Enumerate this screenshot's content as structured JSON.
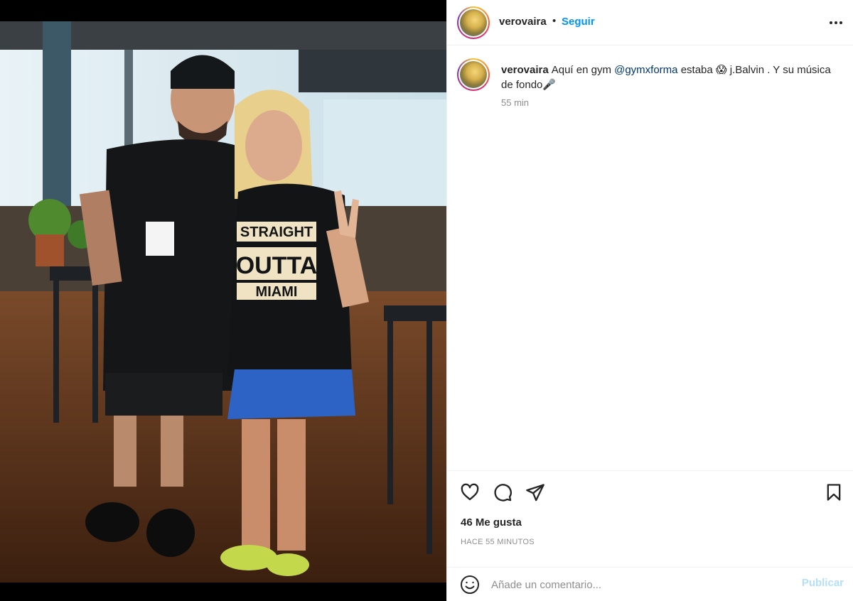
{
  "post": {
    "username": "verovaira",
    "separator": "•",
    "follow_label": "Seguir",
    "more_icon": "more-options-icon",
    "photo_shirt_text": [
      "STRAIGHT",
      "OUTTA",
      "MIAMI"
    ],
    "caption": {
      "username": "verovaira",
      "text_1": "Aquí en gym ",
      "mention": "@gymxforma",
      "text_2": " estaba ",
      "emoji_1": "😱",
      "text_3": " j.Balvin . Y su música de fondo",
      "emoji_2": "🎤"
    },
    "caption_time": "55 min",
    "actions": {
      "like_icon": "heart-icon",
      "comment_icon": "comment-icon",
      "share_icon": "share-icon",
      "save_icon": "bookmark-icon"
    },
    "likes_text": "46 Me gusta",
    "posted_ago": "HACE 55 MINUTOS",
    "comment": {
      "emoji_icon": "smiley-icon",
      "placeholder": "Añade un comentario...",
      "publish_label": "Publicar"
    }
  },
  "colors": {
    "accent_blue": "#0095f6",
    "publish_disabled": "#b2dffc",
    "mention": "#00376b",
    "muted": "#8e8e8e",
    "text": "#262626"
  }
}
